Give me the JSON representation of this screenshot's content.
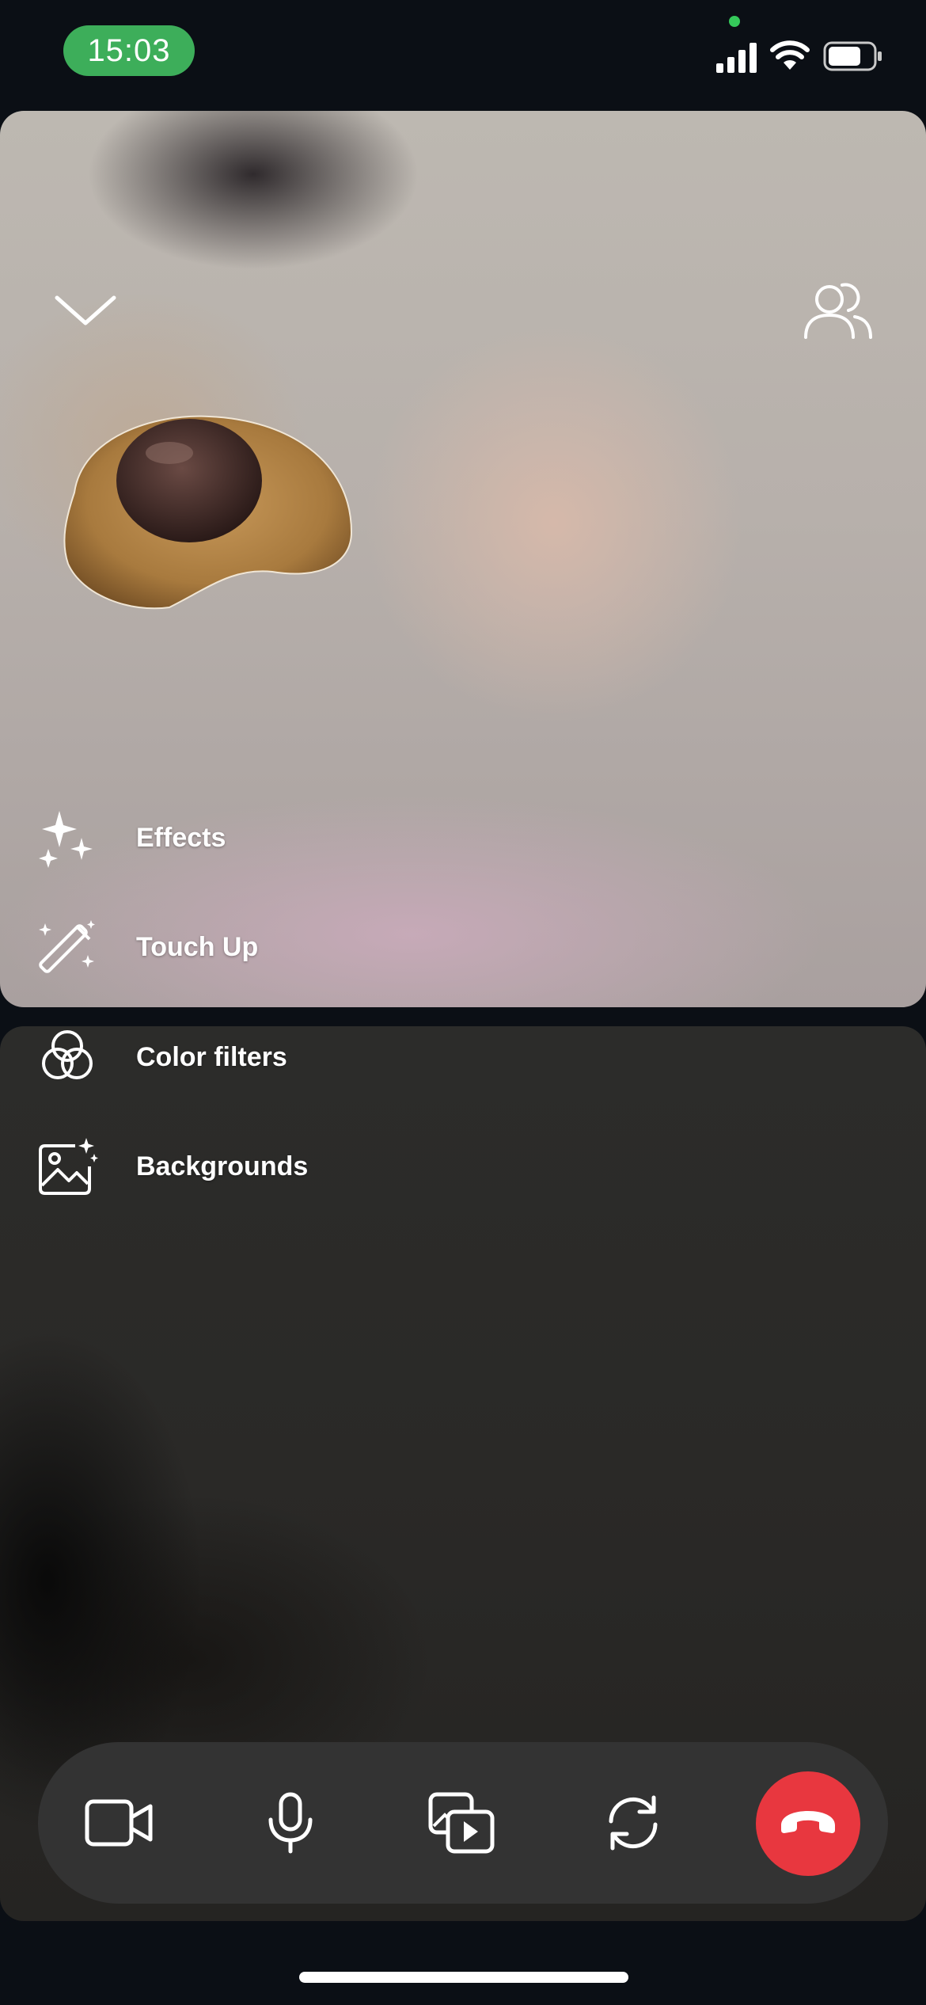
{
  "status_bar": {
    "time": "15:03",
    "icons": [
      "signal-icon",
      "wifi-icon",
      "battery-icon"
    ],
    "accent_color": "#3dae5a"
  },
  "call": {
    "top_actions": [
      "chevron-down-icon",
      "participants-icon"
    ],
    "effects_menu": [
      {
        "label": "Effects",
        "icon": "sparkles-icon"
      },
      {
        "label": "Touch Up",
        "icon": "magic-wand-icon"
      },
      {
        "label": "Color filters",
        "icon": "color-filters-icon"
      },
      {
        "label": "Backgrounds",
        "icon": "backgrounds-icon"
      }
    ]
  },
  "controls": {
    "buttons": [
      "camera-icon",
      "microphone-icon",
      "media-share-icon",
      "flip-camera-icon",
      "end-call-icon"
    ],
    "end_call_color": "#e8373f"
  }
}
